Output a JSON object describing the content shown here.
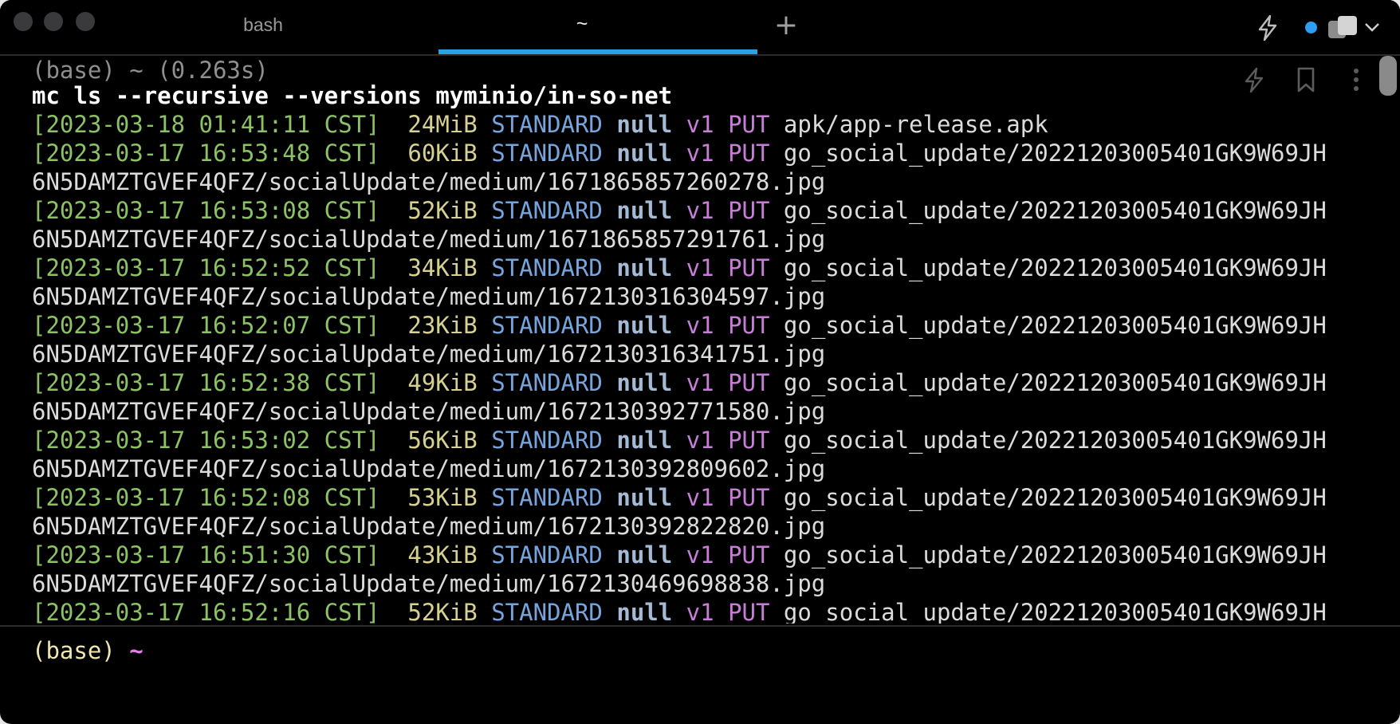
{
  "tabs": [
    {
      "label": "bash",
      "active": false
    },
    {
      "label": "~",
      "active": true
    }
  ],
  "icons": {
    "new_tab": "+",
    "workflow": "bolt-icon",
    "status": "status-dot-icon",
    "profile": "profile-icon",
    "chevron": "chevron-down-icon",
    "block_bolt": "bolt-icon",
    "bookmark": "bookmark-icon",
    "more": "more-vertical-icon"
  },
  "colors": {
    "accent": "#27a3e6",
    "timestamp": "#8cc265",
    "size": "#d6d192",
    "storage_class": "#76a5dd",
    "version_id": "#a4bbd6",
    "version_num": "#c77ed6"
  },
  "block": {
    "header": "(base) ~ (0.263s)",
    "command": "mc ls --recursive --versions myminio/in-so-net",
    "rows": [
      {
        "ts": "[2023-03-18 01:41:11 CST]",
        "size": "24MiB",
        "class": "STANDARD",
        "vid": "null",
        "ver": "v1",
        "op": "PUT",
        "key": "apk/app-release.apk",
        "cont": ""
      },
      {
        "ts": "[2023-03-17 16:53:48 CST]",
        "size": "60KiB",
        "class": "STANDARD",
        "vid": "null",
        "ver": "v1",
        "op": "PUT",
        "key": "go_social_update/20221203005401GK9W69JH",
        "cont": "6N5DAMZTGVEF4QFZ/socialUpdate/medium/1671865857260278.jpg"
      },
      {
        "ts": "[2023-03-17 16:53:08 CST]",
        "size": "52KiB",
        "class": "STANDARD",
        "vid": "null",
        "ver": "v1",
        "op": "PUT",
        "key": "go_social_update/20221203005401GK9W69JH",
        "cont": "6N5DAMZTGVEF4QFZ/socialUpdate/medium/1671865857291761.jpg"
      },
      {
        "ts": "[2023-03-17 16:52:52 CST]",
        "size": "34KiB",
        "class": "STANDARD",
        "vid": "null",
        "ver": "v1",
        "op": "PUT",
        "key": "go_social_update/20221203005401GK9W69JH",
        "cont": "6N5DAMZTGVEF4QFZ/socialUpdate/medium/1672130316304597.jpg"
      },
      {
        "ts": "[2023-03-17 16:52:07 CST]",
        "size": "23KiB",
        "class": "STANDARD",
        "vid": "null",
        "ver": "v1",
        "op": "PUT",
        "key": "go_social_update/20221203005401GK9W69JH",
        "cont": "6N5DAMZTGVEF4QFZ/socialUpdate/medium/1672130316341751.jpg"
      },
      {
        "ts": "[2023-03-17 16:52:38 CST]",
        "size": "49KiB",
        "class": "STANDARD",
        "vid": "null",
        "ver": "v1",
        "op": "PUT",
        "key": "go_social_update/20221203005401GK9W69JH",
        "cont": "6N5DAMZTGVEF4QFZ/socialUpdate/medium/1672130392771580.jpg"
      },
      {
        "ts": "[2023-03-17 16:53:02 CST]",
        "size": "56KiB",
        "class": "STANDARD",
        "vid": "null",
        "ver": "v1",
        "op": "PUT",
        "key": "go_social_update/20221203005401GK9W69JH",
        "cont": "6N5DAMZTGVEF4QFZ/socialUpdate/medium/1672130392809602.jpg"
      },
      {
        "ts": "[2023-03-17 16:52:08 CST]",
        "size": "53KiB",
        "class": "STANDARD",
        "vid": "null",
        "ver": "v1",
        "op": "PUT",
        "key": "go_social_update/20221203005401GK9W69JH",
        "cont": "6N5DAMZTGVEF4QFZ/socialUpdate/medium/1672130392822820.jpg"
      },
      {
        "ts": "[2023-03-17 16:51:30 CST]",
        "size": "43KiB",
        "class": "STANDARD",
        "vid": "null",
        "ver": "v1",
        "op": "PUT",
        "key": "go_social_update/20221203005401GK9W69JH",
        "cont": "6N5DAMZTGVEF4QFZ/socialUpdate/medium/1672130469698838.jpg"
      },
      {
        "ts": "[2023-03-17 16:52:16 CST]",
        "size": "52KiB",
        "class": "STANDARD",
        "vid": "null",
        "ver": "v1",
        "op": "PUT",
        "key": "go_social_update/20221203005401GK9W69JH",
        "cont": ""
      }
    ]
  },
  "prompt": {
    "env": "(base)",
    "dir": "~"
  }
}
